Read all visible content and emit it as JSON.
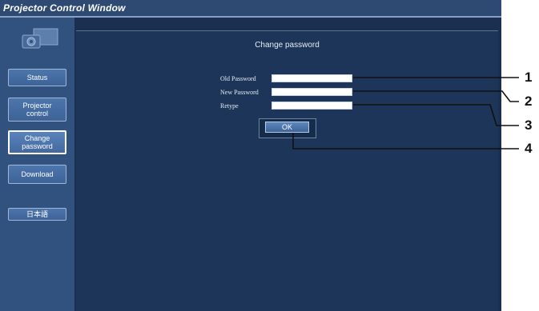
{
  "window": {
    "title": "Projector Control Window"
  },
  "sidebar": {
    "logo_icon": "projector-icon",
    "items": [
      {
        "label": "Status"
      },
      {
        "label": "Projector\ncontrol"
      },
      {
        "label": "Change\npassword",
        "active": true
      },
      {
        "label": "Download"
      },
      {
        "label": "日本語"
      }
    ]
  },
  "main": {
    "title": "Change password",
    "fields": [
      {
        "label": "Old Password",
        "value": ""
      },
      {
        "label": "New Password",
        "value": ""
      },
      {
        "label": "Retype",
        "value": ""
      }
    ],
    "ok_label": "OK"
  },
  "callouts": [
    "1",
    "2",
    "3",
    "4"
  ],
  "colors": {
    "window_bg": "#1b3050",
    "sidebar_bg": "#31527e",
    "button_bg": "#4a73aa",
    "callout": "#111111"
  }
}
